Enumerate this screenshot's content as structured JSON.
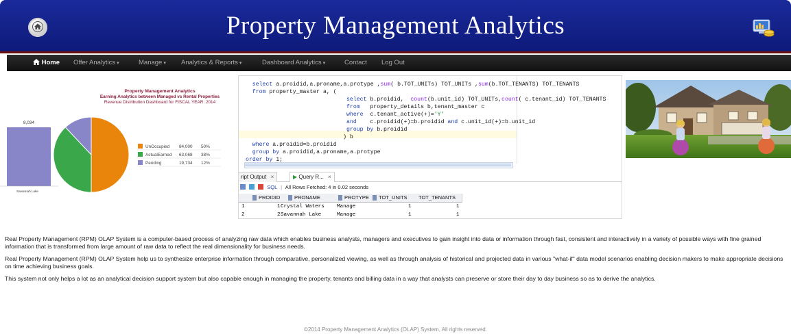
{
  "header": {
    "title": "Property Management Analytics",
    "home_icon": "home-icon",
    "brand_icon": "computer-coins-icon",
    "colors": {
      "banner": "#1a2a9a",
      "border": "#6a0f0f"
    }
  },
  "nav": {
    "items": [
      {
        "label": "Home",
        "icon": "home-icon",
        "active": true,
        "dropdown": false
      },
      {
        "label": "Offer Analytics",
        "dropdown": true
      },
      {
        "label": "Manage",
        "dropdown": true
      },
      {
        "label": "Analytics & Reports",
        "dropdown": true
      },
      {
        "label": "Dashboard Analytics",
        "dropdown": true
      },
      {
        "label": "Contact",
        "dropdown": false
      },
      {
        "label": "Log Out",
        "dropdown": false
      }
    ]
  },
  "chart_data": {
    "type": "pie",
    "title": "Property Management Analytics",
    "subtitle": "Earning Analytics between Managed vs Rental Properties",
    "caption": "Revenue Distribution Dashboard for FISCAL YEAR: 2014",
    "bar": {
      "category": "Savannah Lake",
      "value": "8,034"
    },
    "slices": [
      {
        "label": "UnOccupied",
        "value": "84,000",
        "percent": "50%",
        "share": 50,
        "color": "#e8850a"
      },
      {
        "label": "ActualEarned",
        "value": "63,068",
        "percent": "38%",
        "share": 38,
        "color": "#3aa84a"
      },
      {
        "label": "Pending",
        "value": "19,734",
        "percent": "12%",
        "share": 12,
        "color": "#8886c8"
      }
    ],
    "bar_color": "#8886c8"
  },
  "sql_editor": {
    "lines": [
      {
        "text": "select a.proidid,a.proname,a.protype ,sum( b.TOT_UNITs) TOT_UNITs ,sum(b.TOT_TENANTS) TOT_TENANTS",
        "indent": 2
      },
      {
        "text": "from property_master a, (",
        "indent": 2
      },
      {
        "text": "select b.proidid,  count(b.unit_id) TOT_UNITs,count( c.tenant_id) TOT_TENANTS",
        "indent": 30
      },
      {
        "text": "from   property_details b,tenant_master c",
        "indent": 30
      },
      {
        "text": "where  c.tenant_active(+)='Y'",
        "indent": 30
      },
      {
        "text": "and    c.proidid(+)=b.proidid and c.unit_id(+)=b.unit_id",
        "indent": 30
      },
      {
        "text": "group by b.proidid",
        "indent": 30
      },
      {
        "text": ") b",
        "indent": 29
      },
      {
        "text": "where a.proidid=b.proidid",
        "indent": 2
      },
      {
        "text": "group by a.proidid,a.proname,a.protype",
        "indent": 2
      },
      {
        "text": "order by 1;",
        "indent": 0
      }
    ]
  },
  "results": {
    "tabs": [
      {
        "label": "ript Output",
        "icon": "close-icon"
      },
      {
        "label": "Query R...",
        "icon": "play-icon"
      }
    ],
    "toolbar": {
      "sql_label": "SQL",
      "status": "All Rows Fetched: 4 in 0.02 seconds"
    },
    "columns": [
      "PROIDID",
      "PRONAME",
      "PROTYPE",
      "TOT_UNITS",
      "TOT_TENANTS"
    ],
    "rows": [
      {
        "row": "1",
        "cells": [
          "1",
          "Crystal Waters",
          "Manage",
          "1",
          "1"
        ]
      },
      {
        "row": "2",
        "cells": [
          "2",
          "Savannah Lake",
          "Manage",
          "1",
          "1"
        ]
      }
    ]
  },
  "description": {
    "paragraphs": [
      "Real Property Management (RPM) OLAP System is a computer-based process of analyzing raw data which enables business analysts, managers and executives to gain insight into data or information through fast, consistent and interactively in a variety of possible ways with fine grained information that is transformed from large amount of raw data to reflect the real dimensionality for business needs.",
      "Real Property Management (RPM) OLAP System help us to synthesize enterprise information through comparative, personalized viewing, as well as through analysis of historical and projected data in various \"what-if\" data model scenarios enabling decision makers to make appropriate decisions on time achieving business goals.",
      "This system not only helps a lot as an analytical decision support system but also capable enough in managing the property, tenants and billing data in a way that analysts can preserve or store their day to day business so as to derive the analytics."
    ]
  },
  "footer": {
    "text": "©2014 Property Management Analytics (OLAP) System, All rights reserved."
  }
}
